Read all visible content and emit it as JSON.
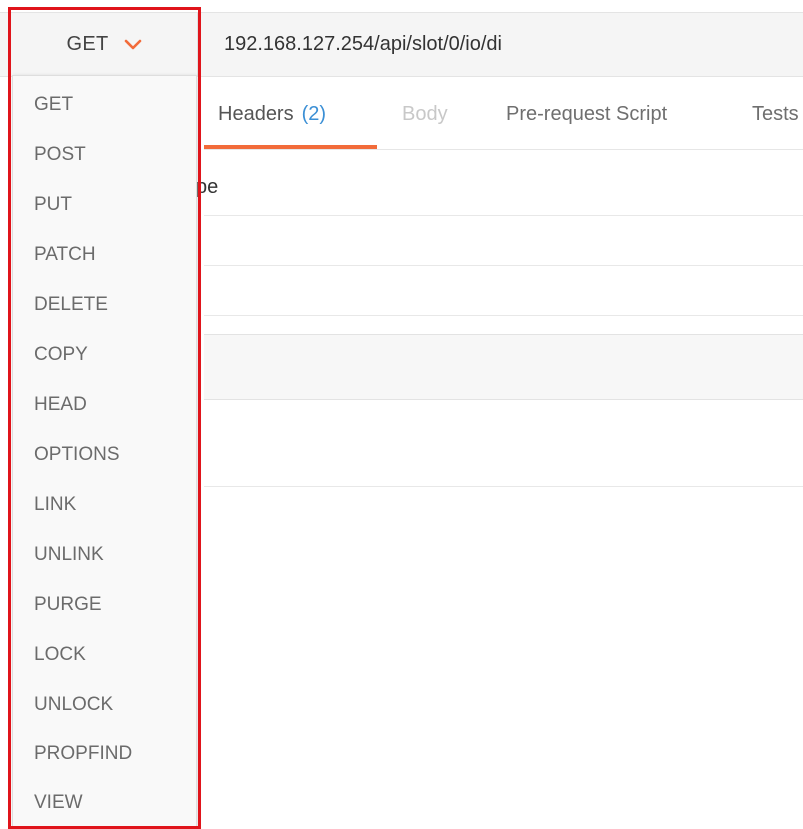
{
  "request": {
    "method": "GET",
    "url": "192.168.127.254/api/slot/0/io/di"
  },
  "tabs": {
    "headers": "Headers",
    "headers_count": "(2)",
    "body": "Body",
    "pre_request_script": "Pre-request Script",
    "tests": "Tests"
  },
  "content": {
    "header_row_fragment": "ype"
  },
  "method_menu": {
    "items": [
      "GET",
      "POST",
      "PUT",
      "PATCH",
      "DELETE",
      "COPY",
      "HEAD",
      "OPTIONS",
      "LINK",
      "UNLINK",
      "PURGE",
      "LOCK",
      "UNLOCK",
      "PROPFIND",
      "VIEW"
    ]
  },
  "icons": {
    "method_toggle": "chevron-down-icon"
  },
  "colors": {
    "accent": "#f26b3a",
    "count_blue": "#3b8fd5",
    "highlight_red": "#e0141b"
  }
}
